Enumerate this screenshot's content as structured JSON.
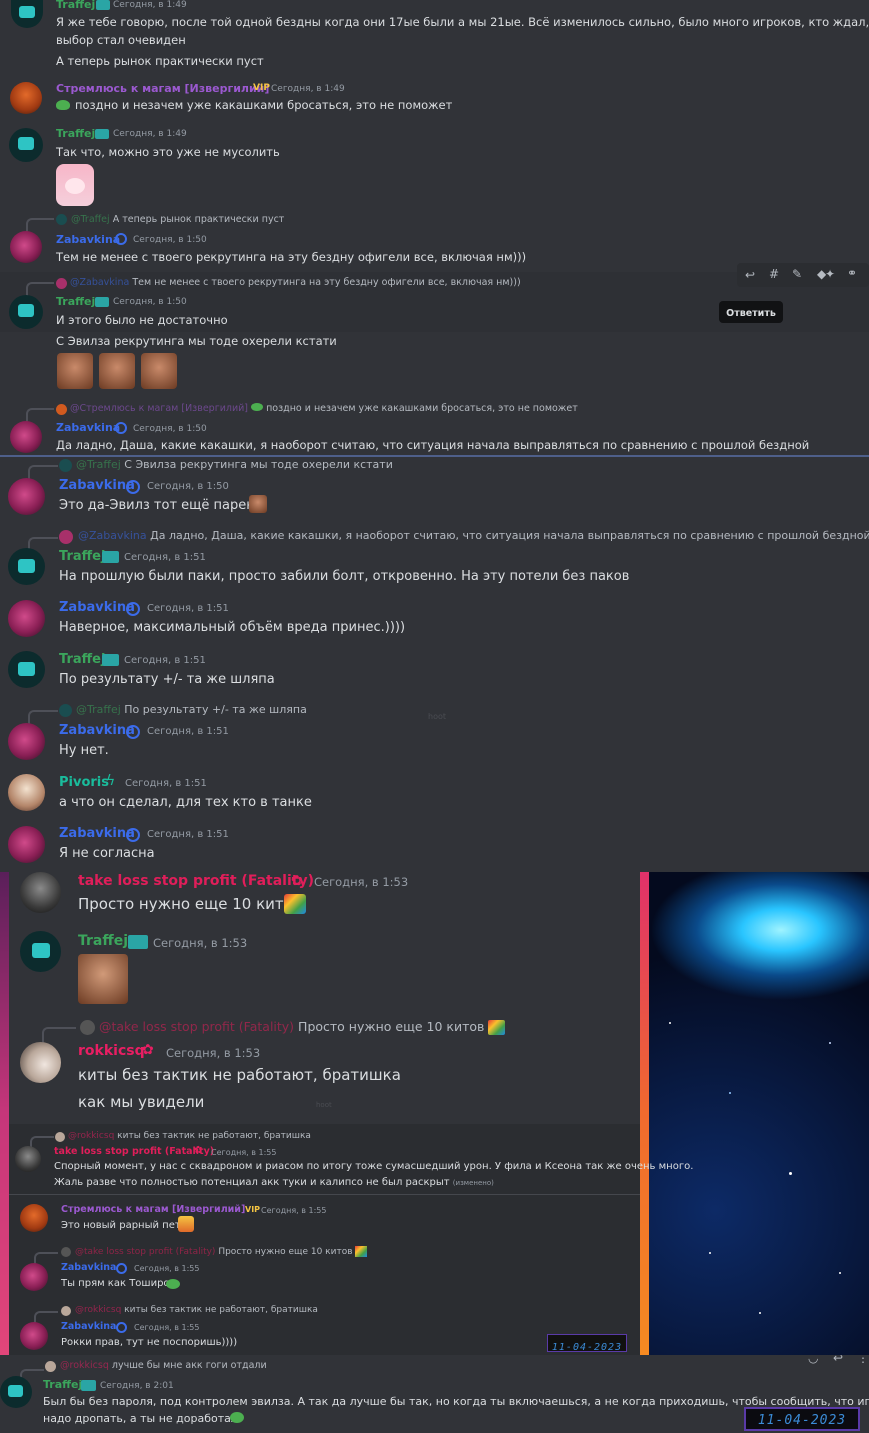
{
  "messages_top": [
    {
      "id": "m1",
      "author": "Traffej",
      "time": "Сегодня, в 1:49",
      "lines": [
        "Я же тебе говорю, после той одной бездны когда они 17ые были а мы 21ые. Всё изменилось сильно, было много игроков, кто ждал, куда пойти. И",
        "выбор стал очевиден",
        "А теперь рынок практически пуст"
      ]
    },
    {
      "id": "m2",
      "author": "Стремлюсь к магам [Извергилий]",
      "badge": "VIP",
      "time": "Сегодня, в 1:49",
      "lines": [
        "поздно и незачем уже какашками бросаться, это не поможет"
      ]
    },
    {
      "id": "m3",
      "author": "Traffej",
      "time": "Сегодня, в 1:49",
      "lines": [
        "Так что, можно это уже не мусолить"
      ]
    },
    {
      "id": "m4",
      "reply_to": "@Traffej",
      "reply_text": "А теперь рынок практически пуст",
      "author": "Zabavkina",
      "time": "Сегодня, в 1:50",
      "lines": [
        "Тем не менее с твоего рекрутинга на эту бездну офигели все, включая нм)))"
      ]
    },
    {
      "id": "m5",
      "reply_to": "@Zabavkina",
      "reply_text": "Тем не менее с твоего рекрутинга на эту бездну офигели все, включая нм)))",
      "author": "Traffej",
      "time": "Сегодня, в 1:50",
      "lines": [
        "И этого было не достаточно",
        "С Эвилза рекрутинга мы тоде охерели кстати"
      ]
    },
    {
      "id": "m6",
      "reply_to": "@Стремлюсь к магам [Извергилий]",
      "reply_text": "поздно и незачем уже какашками бросаться, это не поможет",
      "author": "Zabavkina",
      "time": "Сегодня, в 1:50",
      "lines": [
        "Да ладно, Даша, какие какашки, я наоборот считаю, что ситуация начала выправляться по сравнению с прошлой бездной"
      ]
    }
  ],
  "tooltip": "Ответить",
  "messages_mid": [
    {
      "id": "n1",
      "reply_to": "@Traffej",
      "reply_text": "С Эвилза рекрутинга мы тоде охерели кстати",
      "author": "Zabavkina",
      "time": "Сегодня, в 1:50",
      "lines": [
        "Это да-Эвилз тот ещё парень"
      ]
    },
    {
      "id": "n2",
      "reply_to": "@Zabavkina",
      "reply_text": "Да ладно, Даша, какие какашки, я наоборот считаю, что ситуация начала выправляться по сравнению с прошлой бездной",
      "author": "Traffej",
      "time": "Сегодня, в 1:51",
      "lines": [
        "На прошлую были паки, просто забили болт, откровенно. На эту потели без паков"
      ]
    },
    {
      "id": "n3",
      "author": "Zabavkina",
      "time": "Сегодня, в 1:51",
      "lines": [
        "Наверное, максимальный объём вреда принес.))))"
      ]
    },
    {
      "id": "n4",
      "author": "Traffej",
      "time": "Сегодня, в 1:51",
      "lines": [
        "По результату +/- та же шляпа"
      ]
    },
    {
      "id": "n5",
      "reply_to": "@Traffej",
      "reply_text": "По результату +/- та же шляпа",
      "author": "Zabavkina",
      "time": "Сегодня, в 1:51",
      "lines": [
        "Ну нет."
      ]
    },
    {
      "id": "n6",
      "author": "Pivoris",
      "time": "Сегодня, в 1:51",
      "lines": [
        "а что он сделал, для тех кто в танке"
      ]
    },
    {
      "id": "n7",
      "author": "Zabavkina",
      "time": "Сегодня, в 1:51",
      "lines": [
        "Я не согласна"
      ]
    }
  ],
  "watermark_mid": "hoot",
  "messages_low": [
    {
      "id": "p1",
      "author": "take loss stop profit (Fatality)",
      "time": "Сегодня, в 1:53",
      "lines": [
        "Просто нужно еще 10 китов"
      ]
    },
    {
      "id": "p2",
      "author": "Traffej",
      "time": "Сегодня, в 1:53",
      "lines": []
    },
    {
      "id": "p3",
      "reply_to": "@take loss stop profit (Fatality)",
      "reply_text": "Просто нужно еще 10 китов",
      "author": "rokkicsq",
      "time": "Сегодня, в 1:53",
      "lines": [
        "киты без тактик не работают, братишка",
        "как мы увидели"
      ]
    }
  ],
  "messages_small": [
    {
      "id": "q1",
      "reply_to": "@rokkicsq",
      "reply_text": "киты без тактик не работают, братишка",
      "author": "take loss stop profit (Fatality)",
      "time": "Сегодня, в 1:55",
      "lines": [
        "Спорный момент, у нас с сквадроном и риасом по итогу тоже сумасшедший урон. У фила и Ксеона так же очень много.",
        "Жаль разве что полностью потенциал акк туки и калипсо не был раскрыт"
      ],
      "edited": "(изменено)"
    },
    {
      "id": "q2",
      "author": "Стремлюсь к магам [Извергилий]",
      "badge": "VIP",
      "time": "Сегодня, в 1:55",
      "lines": [
        "Это новый рарный пет"
      ]
    },
    {
      "id": "q3",
      "reply_to": "@take loss stop profit (Fatality)",
      "reply_text": "Просто нужно еще 10 китов",
      "author": "Zabavkina",
      "time": "Сегодня, в 1:55",
      "lines": [
        "Ты прям как Тоширо"
      ]
    },
    {
      "id": "q4",
      "reply_to": "@rokkicsq",
      "reply_text": "киты без тактик не работают, братишка",
      "author": "Zabavkina",
      "time": "Сегодня, в 1:55",
      "lines": [
        "Рокки прав, тут не поспоришь))))"
      ]
    }
  ],
  "date_stamp": "11-04-2023",
  "messages_bottom": [
    {
      "id": "r1",
      "reply_to": "@rokkicsq",
      "reply_text": "лучше бы мне акк гоги отдали",
      "author": "Traffej",
      "time": "Сегодня, в 2:01",
      "lines": [
        "Был бы без пароля, под контролем эвилза. А так да лучше бы так, но когда ты включаешься, а не когда приходишь, чтобы сообщить, что игра гавна,",
        "надо дропать, а ты не доработал"
      ]
    }
  ],
  "colors": {
    "traffej": "#3ba55c",
    "zabavkina": "#3b6bea",
    "vip": "#9b59d0",
    "pivoris": "#1abc9c",
    "fatality": "#e01e5a",
    "rokkicsq": "#e91e63"
  },
  "icons": [
    "reply-icon",
    "thread-icon",
    "edit-icon",
    "pin-icon",
    "link-icon",
    "vip-badge-icon",
    "verified-badge-icon",
    "sprout-badge-icon"
  ]
}
